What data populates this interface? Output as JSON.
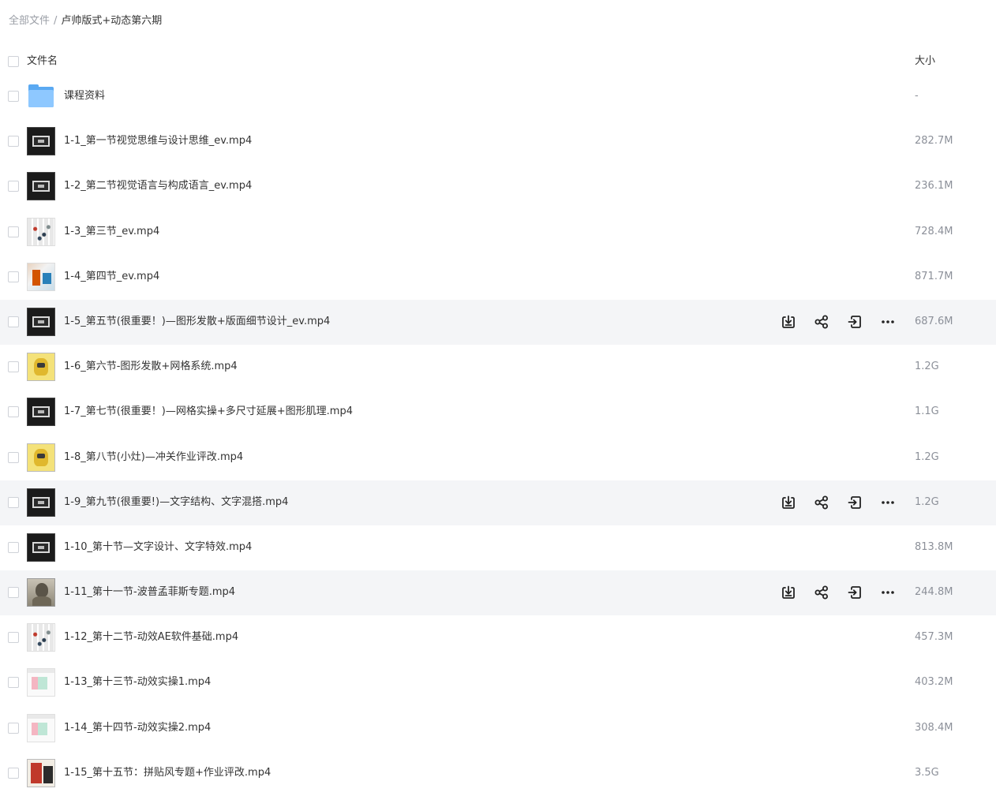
{
  "breadcrumb": {
    "root": "全部文件",
    "separator": "/",
    "current": "卢帅版式+动态第六期"
  },
  "header": {
    "name_label": "文件名",
    "size_label": "大小"
  },
  "icons": {
    "download": "download-icon",
    "share": "share-icon",
    "move": "move-to-icon",
    "more": "more-icon",
    "folder": "folder-icon"
  },
  "colors": {
    "hover_row": "#f4f5f7",
    "folder": "#5aa9f2",
    "text": "#333333",
    "muted": "#8c9099"
  },
  "files": [
    {
      "name": "课程资料",
      "size": "-",
      "kind": "folder",
      "hover": false
    },
    {
      "name": "1-1_第一节视觉思维与设计思维_ev.mp4",
      "size": "282.7M",
      "kind": "dark",
      "hover": false
    },
    {
      "name": "1-2_第二节视觉语言与构成语言_ev.mp4",
      "size": "236.1M",
      "kind": "dark",
      "hover": false
    },
    {
      "name": "1-3_第三节_ev.mp4",
      "size": "728.4M",
      "kind": "grid",
      "hover": false
    },
    {
      "name": "1-4_第四节_ev.mp4",
      "size": "871.7M",
      "kind": "colorful",
      "hover": false
    },
    {
      "name": "1-5_第五节(很重要！)—图形发散+版面细节设计_ev.mp4",
      "size": "687.6M",
      "kind": "dark",
      "hover": true
    },
    {
      "name": "1-6_第六节-图形发散+网格系统.mp4",
      "size": "1.2G",
      "kind": "yellow",
      "hover": false
    },
    {
      "name": "1-7_第七节(很重要！)—网格实操+多尺寸延展+图形肌理.mp4",
      "size": "1.1G",
      "kind": "dark",
      "hover": false
    },
    {
      "name": "1-8_第八节(小灶)—冲关作业评改.mp4",
      "size": "1.2G",
      "kind": "yellow",
      "hover": false
    },
    {
      "name": "1-9_第九节(很重要!)—文字结构、文字混搭.mp4",
      "size": "1.2G",
      "kind": "dark",
      "hover": true
    },
    {
      "name": "1-10_第十节—文字设计、文字特效.mp4",
      "size": "813.8M",
      "kind": "dark",
      "hover": false
    },
    {
      "name": "1-11_第十一节-波普孟菲斯专题.mp4",
      "size": "244.8M",
      "kind": "photo",
      "hover": true
    },
    {
      "name": "1-12_第十二节-动效AE软件基础.mp4",
      "size": "457.3M",
      "kind": "grid",
      "hover": false
    },
    {
      "name": "1-13_第十三节-动效实操1.mp4",
      "size": "403.2M",
      "kind": "light",
      "hover": false
    },
    {
      "name": "1-14_第十四节-动效实操2.mp4",
      "size": "308.4M",
      "kind": "light",
      "hover": false
    },
    {
      "name": "1-15_第十五节：拼贴风专题+作业评改.mp4",
      "size": "3.5G",
      "kind": "collage",
      "hover": false
    }
  ]
}
